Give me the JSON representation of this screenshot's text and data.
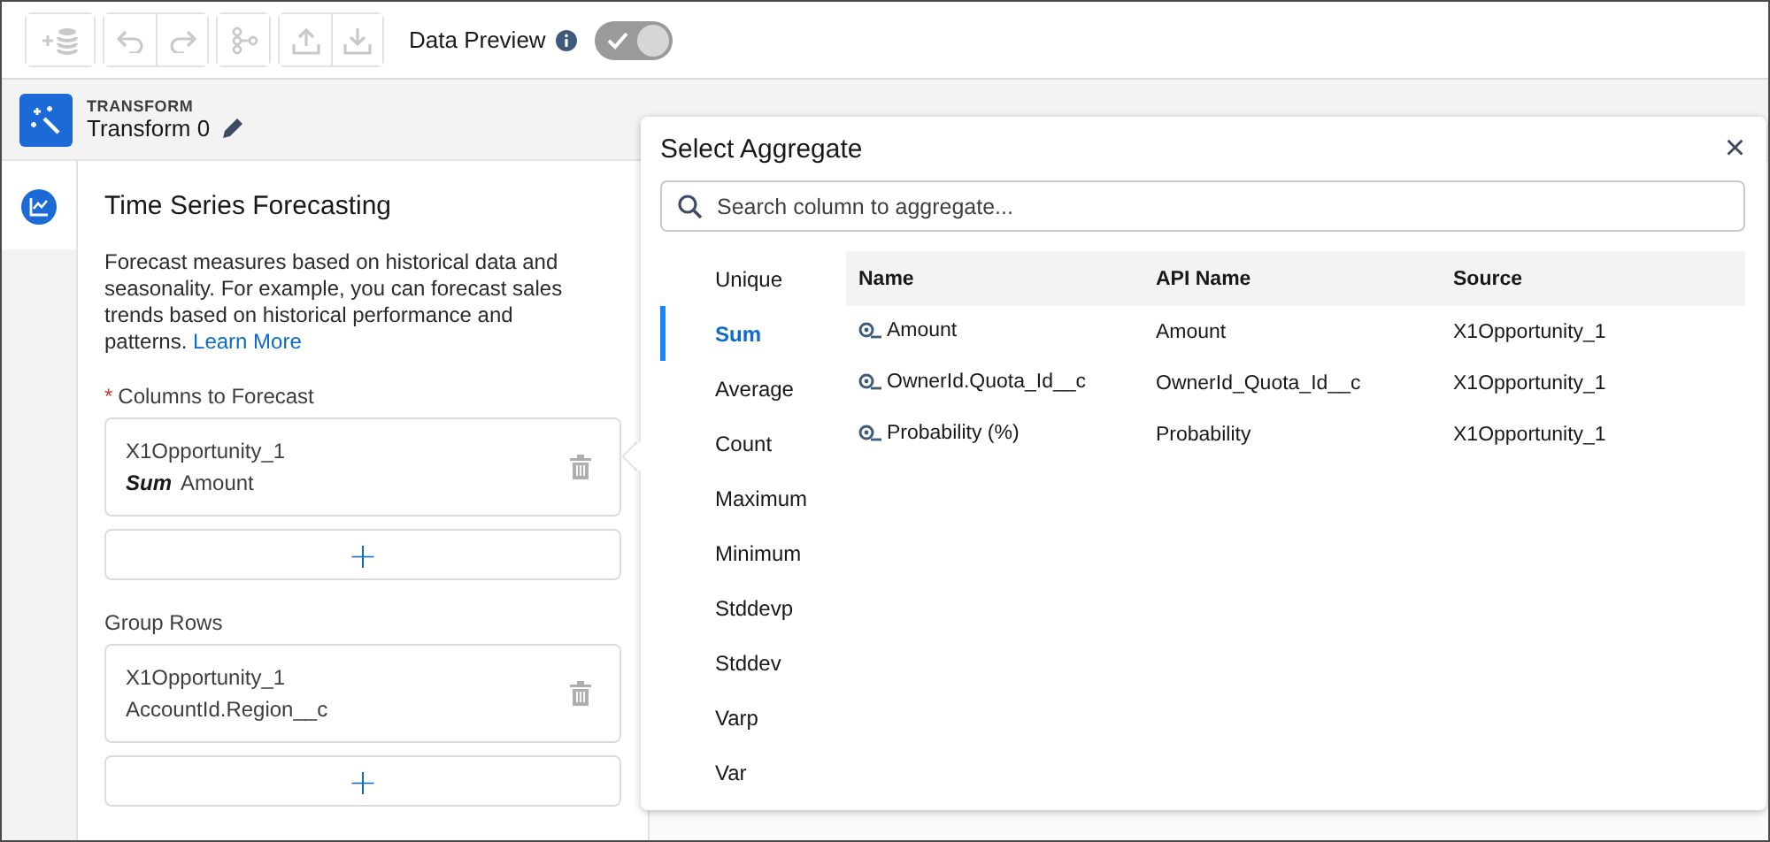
{
  "toolbar": {
    "data_preview": {
      "label": "Data Preview",
      "on": true
    }
  },
  "header": {
    "eyebrow": "TRANSFORM",
    "title": "Transform 0"
  },
  "panel": {
    "title": "Time Series Forecasting",
    "description": "Forecast measures based on historical data and seasonality. For example, you can forecast sales trends based on historical performance and patterns.",
    "link": "Learn More",
    "sections": [
      {
        "label": "Columns to Forecast",
        "required_mark": "*",
        "items": [
          {
            "source": "X1Opportunity_1",
            "aggregate": "Sum",
            "column": "Amount"
          }
        ],
        "add": "+"
      },
      {
        "label": "Group Rows",
        "items": [
          {
            "source": "X1Opportunity_1",
            "column": "AccountId.Region__c"
          }
        ],
        "add": "+"
      }
    ]
  },
  "popover": {
    "title": "Select Aggregate",
    "close": "×",
    "search": {
      "placeholder": "Search column to aggregate..."
    },
    "aggregates": [
      {
        "label": "Unique",
        "selected": false
      },
      {
        "label": "Sum",
        "selected": true
      },
      {
        "label": "Average",
        "selected": false
      },
      {
        "label": "Count",
        "selected": false
      },
      {
        "label": "Maximum",
        "selected": false
      },
      {
        "label": "Minimum",
        "selected": false
      },
      {
        "label": "Stddevp",
        "selected": false
      },
      {
        "label": "Stddev",
        "selected": false
      },
      {
        "label": "Varp",
        "selected": false
      },
      {
        "label": "Var",
        "selected": false
      }
    ],
    "table": {
      "columns": [
        "Name",
        "API Name",
        "Source"
      ],
      "rows": [
        [
          "Amount",
          "Amount",
          "X1Opportunity_1"
        ],
        [
          "OwnerId.Quota_Id__c",
          "OwnerId_Quota_Id__c",
          "X1Opportunity_1"
        ],
        [
          "Probability (%)",
          "Probability",
          "X1Opportunity_1"
        ]
      ]
    }
  }
}
